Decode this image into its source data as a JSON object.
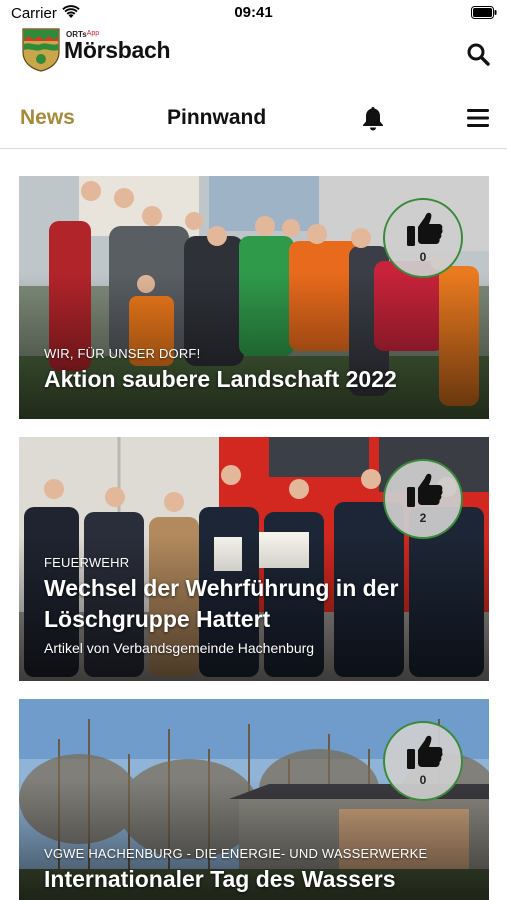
{
  "status": {
    "carrier": "Carrier",
    "time": "09:41"
  },
  "header": {
    "badge": "ORTs",
    "badge_app": "App",
    "town": "Mörsbach"
  },
  "tabs": [
    {
      "label": "News"
    },
    {
      "label": "Pinnwand"
    }
  ],
  "colors": {
    "accent": "#a88a3c",
    "like_border": "#3a8a3a"
  },
  "icons": [
    "wifi-icon",
    "battery-icon",
    "search-icon",
    "bell-icon",
    "hamburger-menu-icon",
    "thumbs-up-icon"
  ],
  "cards": [
    {
      "kicker": "WIR, FÜR UNSER DORF!",
      "title": "Aktion saubere Landschaft 2022",
      "subtitle": "",
      "likes": "0"
    },
    {
      "kicker": "FEUERWEHR",
      "title": "Wechsel der Wehrführung in der Löschgruppe Hattert",
      "subtitle": "Artikel von Verbandsgemeinde Hachenburg",
      "likes": "2"
    },
    {
      "kicker": "VGWE HACHENBURG - DIE ENERGIE- UND WASSERWERKE",
      "title": "Internationaler Tag des Wassers",
      "subtitle": "",
      "likes": "0"
    }
  ]
}
